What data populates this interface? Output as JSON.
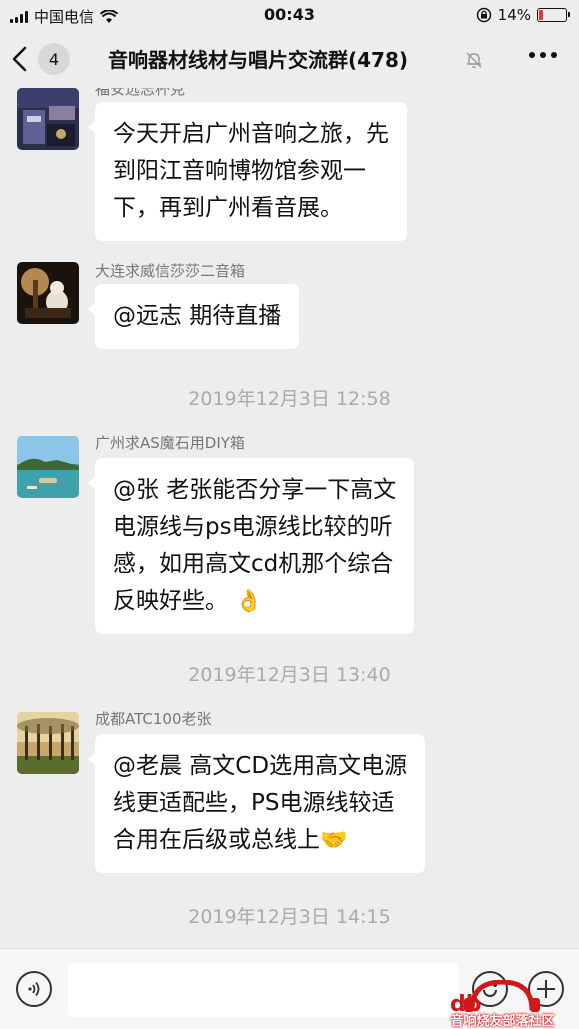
{
  "status_bar": {
    "carrier": "中国电信",
    "time": "00:43",
    "battery_percent": "14%",
    "battery_level": 0.14,
    "colors": {
      "battery_low": "#e53935"
    }
  },
  "nav": {
    "back_count": "4",
    "title": "音响器材线材与唱片交流群(478)",
    "icons": [
      "chevron-left-icon",
      "mute-bell-icon",
      "more-dots-icon"
    ]
  },
  "messages": [
    {
      "sender": "福安远志杯克",
      "text": "今天开启广州音响之旅，先到阳江音响博物馆参观一下，再到广州看音展。",
      "lines": [
        "今天开启广州音响之旅，先",
        "到阳江音响博物馆参观一",
        "下，再到广州看音展。"
      ]
    },
    {
      "sender": "大连求威信莎莎二音箱",
      "lines": [
        "@远志 期待直播"
      ]
    },
    {
      "sender": "广州求AS魔石用DIY箱",
      "lines": [
        "@张 老张能否分享一下高文",
        "电源线与ps电源线比较的听",
        "感，如用高文cd机那个综合",
        "反映好些。"
      ],
      "emoji": "👌"
    },
    {
      "sender": "成都ATC100老张",
      "lines": [
        "@老晨 高文CD选用高文电源",
        "线更适配些，PS电源线较适",
        "合用在后级或总线上"
      ],
      "emoji": "🤝"
    }
  ],
  "timestamps": [
    "2019年12月3日 12:58",
    "2019年12月3日 13:40",
    "2019年12月3日 14:15"
  ],
  "input_bar": {
    "placeholder": "",
    "icons": [
      "voice-icon",
      "emoji-icon",
      "plus-icon"
    ]
  },
  "watermark": {
    "logo_text": "db",
    "caption": "音响烧友部落社区"
  }
}
